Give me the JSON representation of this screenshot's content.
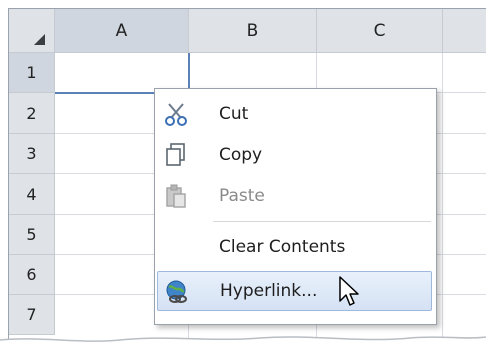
{
  "sheet": {
    "columns": [
      "A",
      "B",
      "C"
    ],
    "rows": [
      "1",
      "2",
      "3",
      "4",
      "5",
      "6",
      "7"
    ],
    "selected_column": "A",
    "selected_row": "1"
  },
  "context_menu": {
    "items": [
      {
        "label": "Cut",
        "icon": "scissors-icon",
        "enabled": true
      },
      {
        "label": "Copy",
        "icon": "copy-icon",
        "enabled": true
      },
      {
        "label": "Paste",
        "icon": "paste-icon",
        "enabled": false
      },
      {
        "label": "Clear Contents",
        "icon": "",
        "enabled": true
      },
      {
        "label": "Hyperlink...",
        "icon": "hyperlink-globe-icon",
        "enabled": true,
        "highlighted": true
      }
    ]
  },
  "colors": {
    "header_bg": "#dfe3e8",
    "selection_border": "#5b83b8",
    "menu_highlight": "#d5e2f4"
  }
}
